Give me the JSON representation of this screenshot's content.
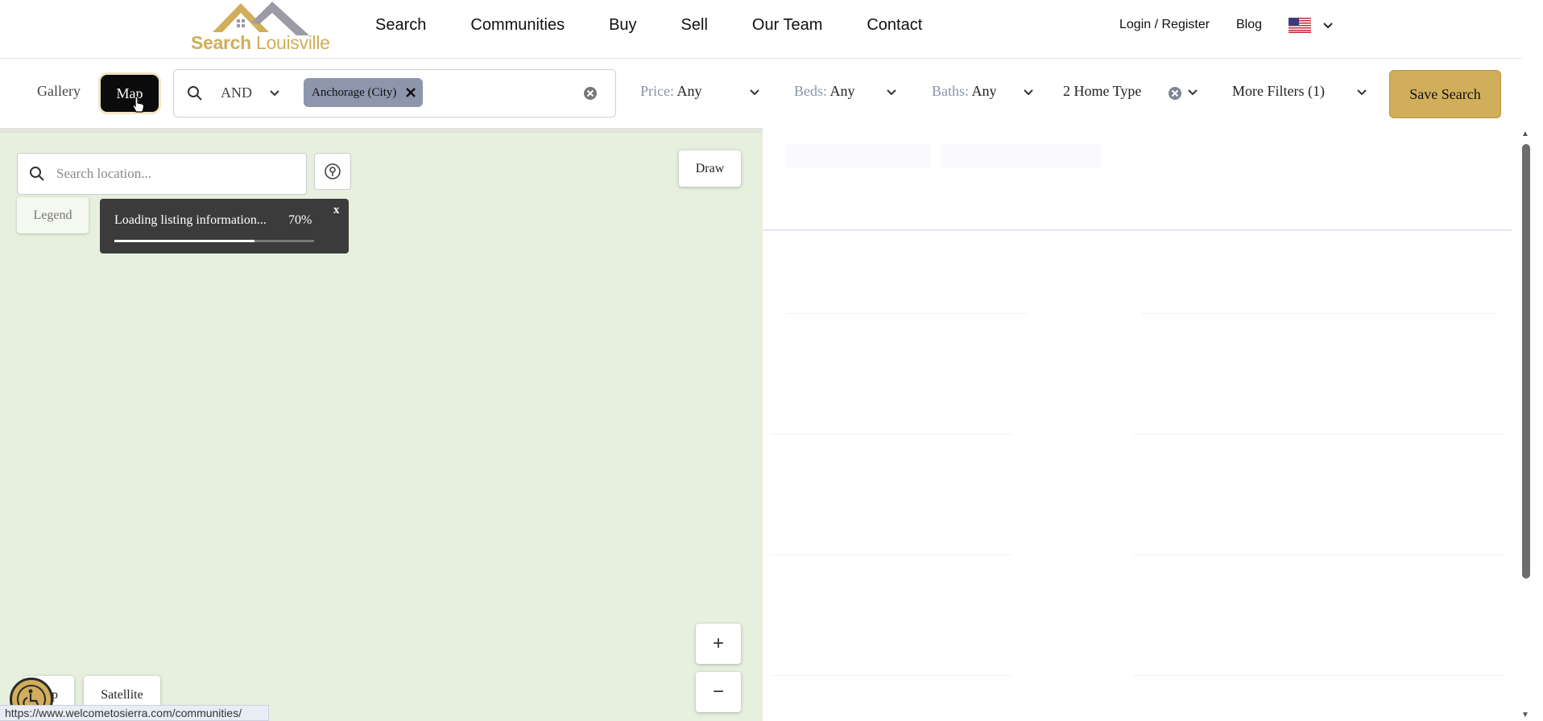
{
  "header": {
    "logo": {
      "word_bold": "Search",
      "word_thin": "Louisville"
    },
    "nav": [
      "Search",
      "Communities",
      "Buy",
      "Sell",
      "Our Team",
      "Contact"
    ],
    "login_label": "Login / Register",
    "blog_label": "Blog",
    "language_icon": "us-flag-icon"
  },
  "filters": {
    "view_tabs": {
      "gallery": "Gallery",
      "map": "Map",
      "active": "Map"
    },
    "search": {
      "operator": "AND",
      "chips": [
        "Anchorage (City)"
      ]
    },
    "price": {
      "label": "Price:",
      "value": "Any"
    },
    "beds": {
      "label": "Beds:",
      "value": "Any"
    },
    "baths": {
      "label": "Baths:",
      "value": "Any"
    },
    "home_type": "2 Home Type",
    "more_filters": "More Filters (1)",
    "save_search": "Save Search"
  },
  "map": {
    "search_placeholder": "Search location...",
    "draw_label": "Draw",
    "legend_label": "Legend",
    "loading": {
      "text": "Loading listing information...",
      "percent_label": "70%",
      "progress": 0.7,
      "close_label": "x"
    },
    "zoom_in": "+",
    "zoom_out": "−",
    "map_type_partial": "p",
    "satellite_label": "Satellite"
  },
  "status_url": "https://www.welcometosierra.com/communities/",
  "colors": {
    "brand_gold": "#d0ae5a",
    "chip_bg": "#8d96ad",
    "map_bg": "#e7efdf",
    "loading_bg": "#3b3b3b"
  }
}
